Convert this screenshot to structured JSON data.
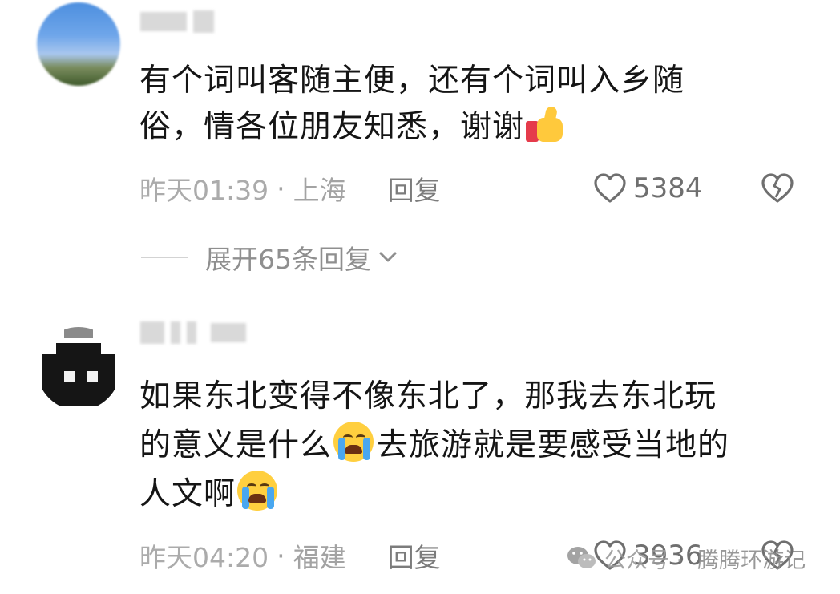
{
  "comments": [
    {
      "username": "",
      "text_lines": [
        "有个词叫客随主便，还有个词叫入乡随",
        "俗，情各位朋友知悉，谢谢"
      ],
      "time": "昨天01:39",
      "sep": "·",
      "location": "上海",
      "reply_label": "回复",
      "likes": "5384",
      "expand_label": "展开65条回复"
    },
    {
      "username": "",
      "text_lines": [
        "如果东北变得不像东北了，那我去东北玩",
        "的意义是什么",
        "去旅游就是要感受当地的",
        "人文啊"
      ],
      "time": "昨天04:20",
      "sep": "·",
      "location": "福建",
      "reply_label": "回复",
      "likes": "3936"
    }
  ],
  "watermark": {
    "prefix": "公众号 ·",
    "name": "腾腾环游记"
  },
  "icons": {
    "like": "heart-outline-icon",
    "dislike": "broken-heart-icon",
    "expand": "chevron-down-icon",
    "emoji_1": "thumbs-up-emoji",
    "emoji_2": "crying-face-emoji",
    "watermark": "wechat-icon"
  },
  "colors": {
    "text": "#151515",
    "meta": "#a3a3a3",
    "like": "#6f6f6f"
  }
}
